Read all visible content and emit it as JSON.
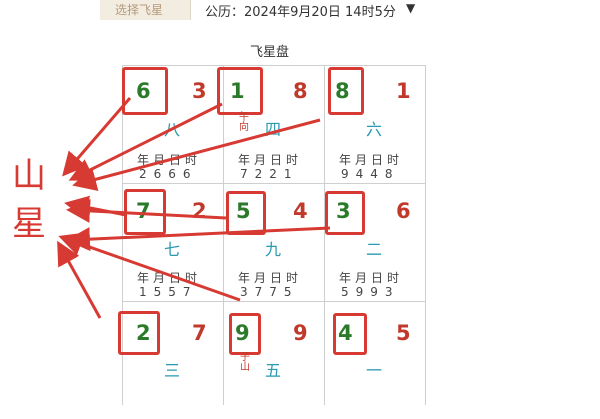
{
  "header": {
    "select_tab": "选择飞星",
    "date_text": "公历：2024年9月20日 14时5分",
    "caret": "▼"
  },
  "board": {
    "title": "飞星盘",
    "cells": [
      {
        "mountain": "6",
        "water": "3",
        "yun": "八",
        "headers": "年月日时",
        "nums": "2666",
        "tag": ""
      },
      {
        "mountain": "1",
        "water": "8",
        "yun": "四",
        "headers": "年月日时",
        "nums": "7221",
        "tag": "午向"
      },
      {
        "mountain": "8",
        "water": "1",
        "yun": "六",
        "headers": "年月日时",
        "nums": "9448",
        "tag": ""
      },
      {
        "mountain": "7",
        "water": "2",
        "yun": "七",
        "headers": "年月日时",
        "nums": "1557",
        "tag": ""
      },
      {
        "mountain": "5",
        "water": "4",
        "yun": "九",
        "headers": "年月日时",
        "nums": "3775",
        "tag": ""
      },
      {
        "mountain": "3",
        "water": "6",
        "yun": "二",
        "headers": "年月日时",
        "nums": "5993",
        "tag": ""
      },
      {
        "mountain": "2",
        "water": "7",
        "yun": "三",
        "headers": "",
        "nums": "",
        "tag": ""
      },
      {
        "mountain": "9",
        "water": "9",
        "yun": "五",
        "headers": "",
        "nums": "",
        "tag": "子山"
      },
      {
        "mountain": "4",
        "water": "5",
        "yun": "一",
        "headers": "",
        "nums": "",
        "tag": ""
      }
    ]
  },
  "annotation": {
    "label_line1": "山",
    "label_line2": "星",
    "color": "#d73a32"
  }
}
